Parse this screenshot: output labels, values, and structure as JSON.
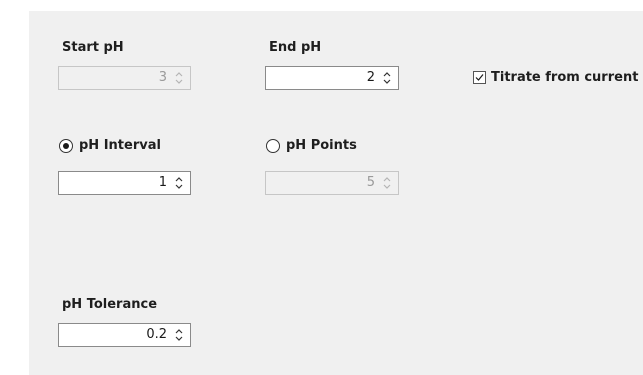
{
  "start_ph": {
    "label": "Start pH",
    "value": "3",
    "enabled": false
  },
  "end_ph": {
    "label": "End pH",
    "value": "2",
    "enabled": true
  },
  "titrate_from_current": {
    "label": "Titrate from current p",
    "checked": true
  },
  "ph_interval": {
    "label": "pH Interval",
    "selected": true,
    "value": "1",
    "enabled": true
  },
  "ph_points": {
    "label": "pH Points",
    "selected": false,
    "value": "5",
    "enabled": false
  },
  "ph_tolerance": {
    "label": "pH Tolerance",
    "value": "0.2",
    "enabled": true
  },
  "icons": {
    "spin_arrows": "up-down-chevron-icon",
    "check": "checkmark-icon",
    "radio_on": "radio-selected-icon",
    "radio_off": "radio-unselected-icon"
  }
}
